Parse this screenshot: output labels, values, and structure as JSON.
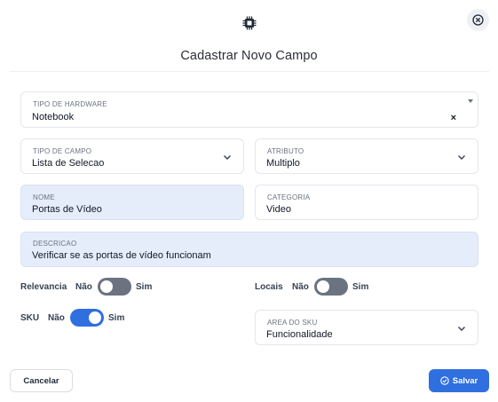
{
  "modal": {
    "title": "Cadastrar Novo Campo",
    "icons": {
      "header": "chip-icon",
      "close": "close-circle-icon"
    }
  },
  "fields": {
    "hardware_type": {
      "label": "TIPO DE HARDWARE",
      "value": "Notebook",
      "clear": "×"
    },
    "field_type": {
      "label": "TIPO DE CAMPO",
      "value": "Lista de Selecao"
    },
    "attribute": {
      "label": "ATRIBUTO",
      "value": "Multiplo"
    },
    "name": {
      "label": "NOME",
      "value": "Portas de Vídeo"
    },
    "category": {
      "label": "CATEGORIA",
      "value": "Video"
    },
    "description": {
      "label": "DESCRICAO",
      "value": "Verificar se as portas de vídeo funcionam"
    },
    "sku_area": {
      "label": "AREA DO SKU",
      "value": "Funcionalidade"
    }
  },
  "toggles": {
    "relevancia": {
      "label": "Relevancia",
      "no": "Não",
      "yes": "Sim",
      "on": false
    },
    "locais": {
      "label": "Locais",
      "no": "Não",
      "yes": "Sim",
      "on": false
    },
    "sku": {
      "label": "SKU",
      "no": "Não",
      "yes": "Sim",
      "on": true
    }
  },
  "buttons": {
    "cancel": "Cancelar",
    "save": "Salvar"
  },
  "colors": {
    "accent": "#2f6fe0",
    "filled_field": "#e6edfa",
    "toggle_off": "#6b7280"
  }
}
